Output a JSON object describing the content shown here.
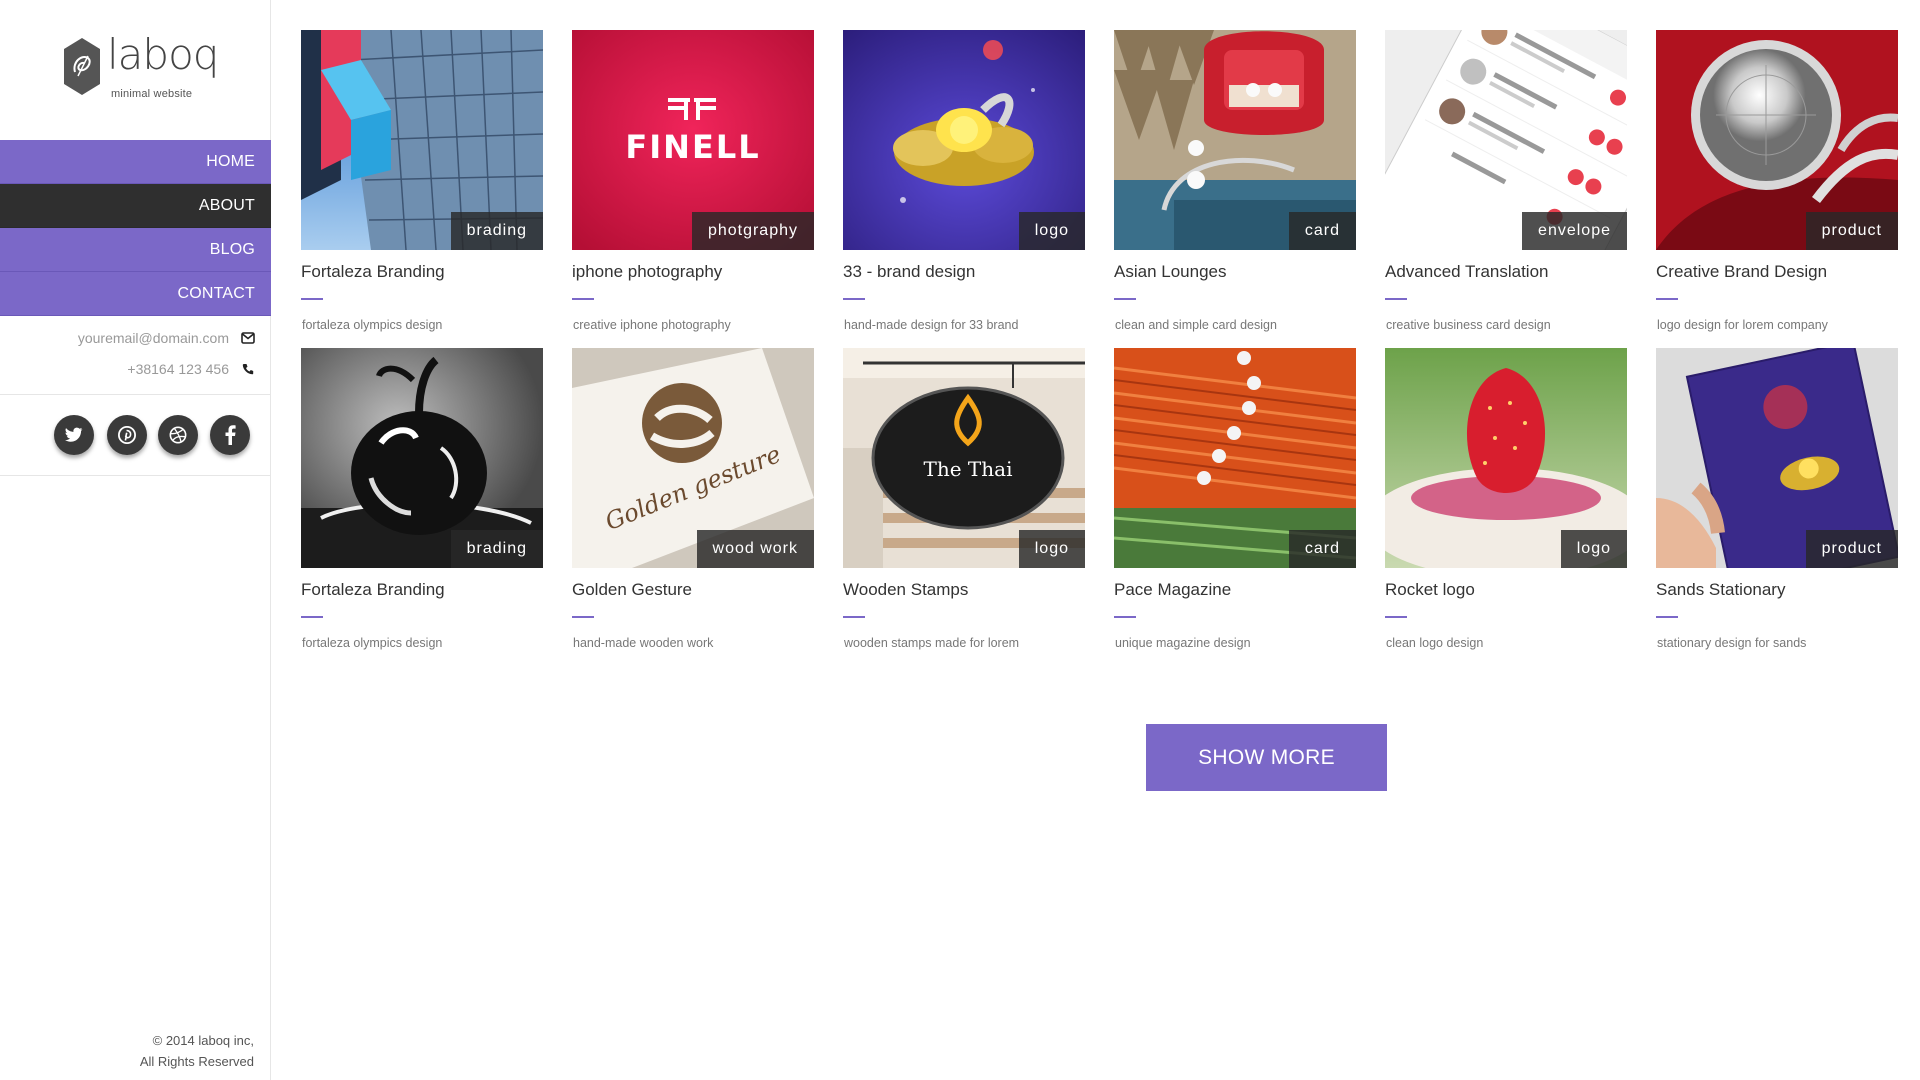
{
  "brand": {
    "name": "laboq",
    "tagline": "minimal website"
  },
  "nav": [
    {
      "label": "HOME"
    },
    {
      "label": "ABOUT"
    },
    {
      "label": "BLOG"
    },
    {
      "label": "CONTACT"
    }
  ],
  "contact": {
    "email": "youremail@domain.com",
    "phone": "+38164 123 456"
  },
  "social": [
    "twitter-icon",
    "pinterest-icon",
    "dribbble-icon",
    "facebook-icon"
  ],
  "portfolio": [
    {
      "title": "Fortaleza Branding",
      "tag": "brading",
      "desc": "fortaleza olympics design"
    },
    {
      "title": "iphone photography",
      "tag": "photgraphy",
      "desc": "creative iphone photography",
      "image_text": "FINELL"
    },
    {
      "title": "33 - brand design",
      "tag": "logo",
      "desc": "hand-made design for 33 brand"
    },
    {
      "title": "Asian Lounges",
      "tag": "card",
      "desc": "clean and simple card design"
    },
    {
      "title": "Advanced Translation",
      "tag": "envelope",
      "desc": "creative business card design"
    },
    {
      "title": "Creative Brand Design",
      "tag": "product",
      "desc": "logo design for lorem company"
    },
    {
      "title": "Fortaleza Branding",
      "tag": "brading",
      "desc": "fortaleza olympics design"
    },
    {
      "title": "Golden Gesture",
      "tag": "wood work",
      "desc": "hand-made wooden work",
      "image_text": "Golden gesture"
    },
    {
      "title": "Wooden Stamps",
      "tag": "logo",
      "desc": "wooden stamps made for lorem",
      "image_text": "The Thai"
    },
    {
      "title": "Pace Magazine",
      "tag": "card",
      "desc": "unique magazine design"
    },
    {
      "title": "Rocket logo",
      "tag": "logo",
      "desc": "clean logo design"
    },
    {
      "title": "Sands Stationary",
      "tag": "product",
      "desc": "stationary design for sands"
    }
  ],
  "show_more": "SHOW MORE",
  "copyright": {
    "line1": "© 2014 laboq inc,",
    "line2": "All Rights Reserved"
  },
  "colors": {
    "accent": "#7b68c8",
    "nav_active": "#2f2f2f",
    "tag_bg": "#282828"
  }
}
